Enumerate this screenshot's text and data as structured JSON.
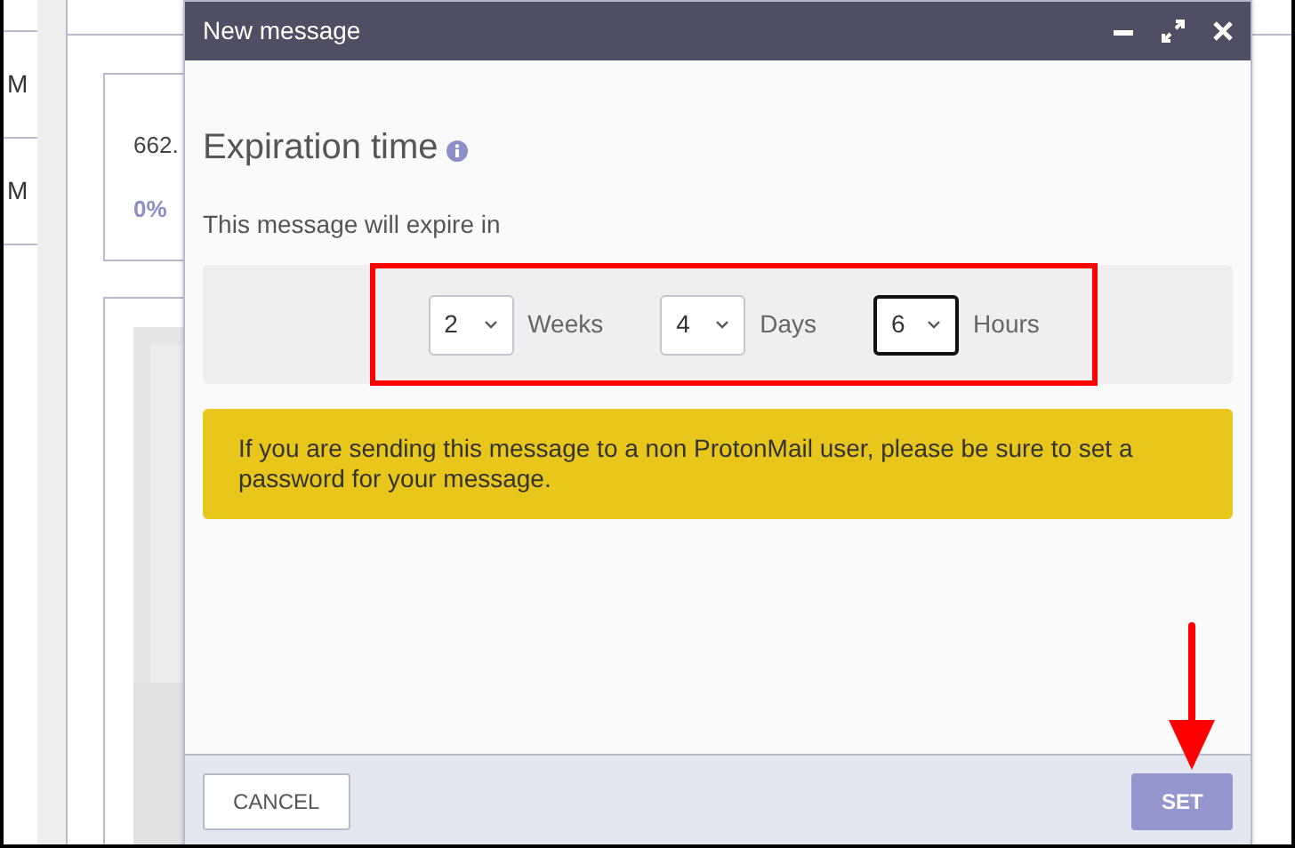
{
  "background": {
    "side_labels": [
      "M",
      "M"
    ],
    "card": {
      "value": "662.",
      "stat": "0%"
    }
  },
  "dialog": {
    "title": "New message",
    "heading": "Expiration time",
    "subtitle": "This message will expire in",
    "selects": [
      {
        "value": "2",
        "unit": "Weeks",
        "focused": false
      },
      {
        "value": "4",
        "unit": "Days",
        "focused": false
      },
      {
        "value": "6",
        "unit": "Hours",
        "focused": true
      }
    ],
    "alert": "If you are sending this message to a non ProtonMail user, please be sure to set a password for your message.",
    "buttons": [
      {
        "label": "CANCEL",
        "kind": "secondary"
      },
      {
        "label": "SET",
        "kind": "primary"
      }
    ]
  }
}
